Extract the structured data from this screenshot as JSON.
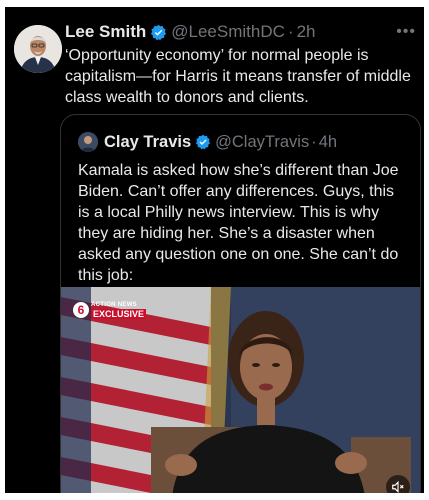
{
  "post": {
    "author_name": "Lee Smith",
    "author_handle": "@LeeSmithDC",
    "separator": "·",
    "time": "2h",
    "more_icon": "more-horizontal-icon",
    "text": "‘Opportunity economy’ for normal people is capitalism—for Harris it means transfer of middle class wealth to donors and clients."
  },
  "quote": {
    "author_name": "Clay Travis",
    "author_handle": "@ClayTravis",
    "separator": "·",
    "time": "4h",
    "text": "Kamala is asked how she’s different than Joe Biden. Can’t offer any differences. Guys, this is a local Philly news interview. This is why they are hiding her. She’s a disaster when asked any question one on one. She can’t do this job:",
    "media": {
      "badge_top": "ACTION NEWS",
      "badge_bottom": "EXCLUSIVE",
      "badge_logo": "6",
      "mute_icon": "speaker-muted-icon"
    }
  },
  "colors": {
    "background": "#000000",
    "text": "#e7e9ea",
    "secondary_text": "#71767b",
    "border": "#2f3336",
    "verified": "#1d9bf0",
    "news_red": "#c8102e"
  }
}
